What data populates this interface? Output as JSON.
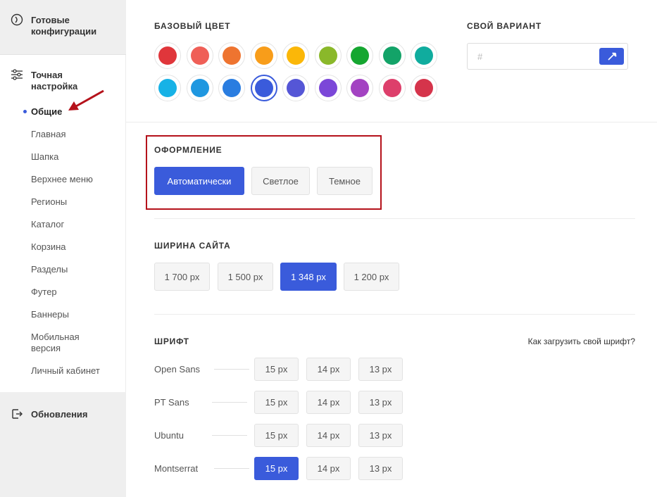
{
  "sidebar": {
    "ready": "Готовые конфигурации",
    "fine": "Точная настройка",
    "items": [
      "Общие",
      "Главная",
      "Шапка",
      "Верхнее меню",
      "Регионы",
      "Каталог",
      "Корзина",
      "Разделы",
      "Футер",
      "Баннеры",
      "Мобильная версия",
      "Личный кабинет"
    ],
    "updates": "Обновления"
  },
  "base_color": {
    "title": "БАЗОВЫЙ ЦВЕТ",
    "colors": [
      "#e0363b",
      "#ef5f57",
      "#ee7430",
      "#f89d1a",
      "#fbb708",
      "#8ab82a",
      "#15a630",
      "#13a368",
      "#10ac9e",
      "#17b2e6",
      "#1f97e0",
      "#2a7de0",
      "#3a5bdb",
      "#5556d6",
      "#7b47d8",
      "#a343c2",
      "#dd3f6b",
      "#d5344b"
    ],
    "selected": "#3a5bdb"
  },
  "custom": {
    "title": "СВОЙ ВАРИАНТ",
    "placeholder": "#"
  },
  "appearance": {
    "title": "ОФОРМЛЕНИЕ",
    "options": [
      "Автоматически",
      "Светлое",
      "Темное"
    ],
    "selected": "Автоматически"
  },
  "width": {
    "title": "ШИРИНА САЙТА",
    "options": [
      "1 700 px",
      "1 500 px",
      "1 348 px",
      "1 200 px"
    ],
    "selected": "1 348 px"
  },
  "font": {
    "title": "ШРИФТ",
    "help_link": "Как загрузить свой шрифт?",
    "sizes": [
      "15 px",
      "14 px",
      "13 px"
    ],
    "fonts": [
      {
        "name": "Open Sans",
        "selected": ""
      },
      {
        "name": "PT Sans",
        "selected": ""
      },
      {
        "name": "Ubuntu",
        "selected": ""
      },
      {
        "name": "Montserrat",
        "selected": "15 px"
      }
    ]
  },
  "colors": {
    "accent": "#3a5bdb",
    "annotation": "#b5121b"
  }
}
